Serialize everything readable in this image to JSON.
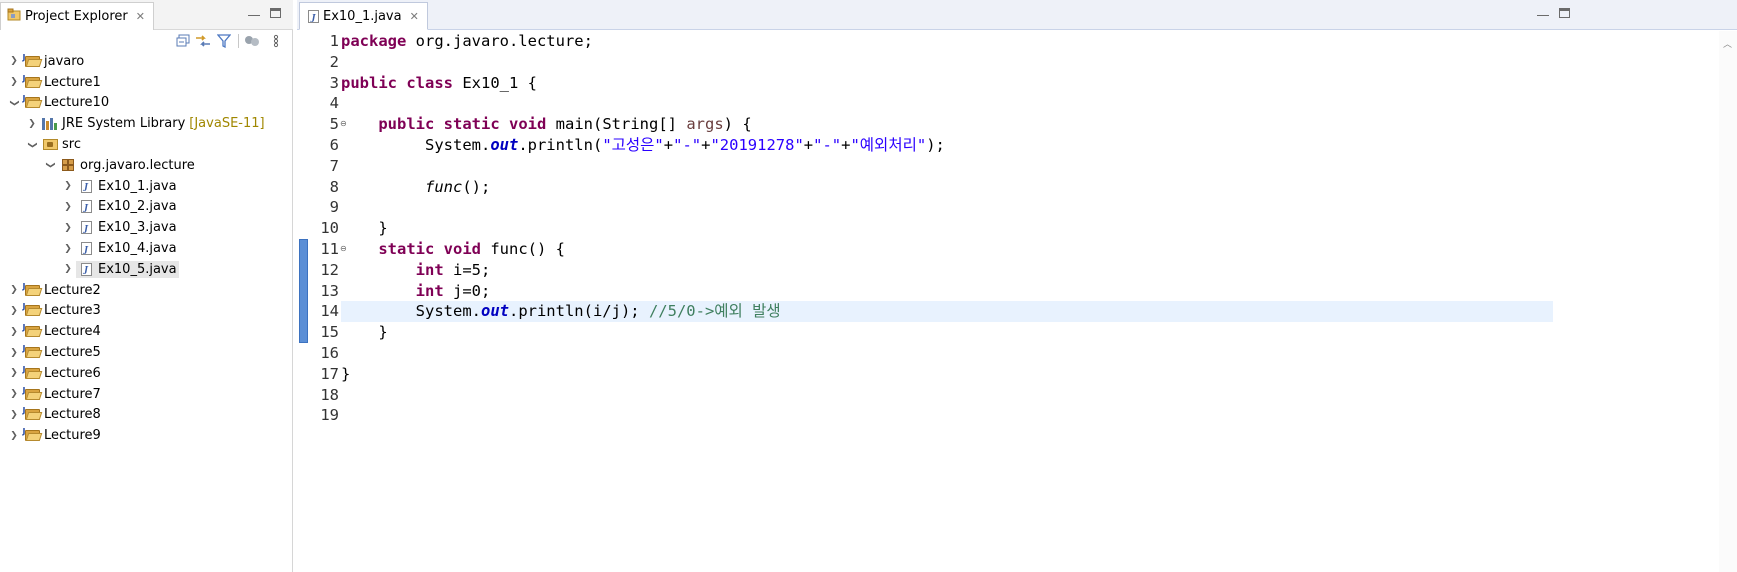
{
  "left_panel": {
    "tab_title": "Project Explorer",
    "tree": [
      {
        "label": "javaro",
        "decor": "",
        "kind": "project"
      },
      {
        "label": "Lecture1",
        "decor": "",
        "kind": "project"
      },
      {
        "label": "Lecture10",
        "decor": "",
        "kind": "project"
      },
      {
        "label": "JRE System Library",
        "decor": "[JavaSE-11]",
        "kind": "library"
      },
      {
        "label": "src",
        "decor": "",
        "kind": "src"
      },
      {
        "label": "org.javaro.lecture",
        "decor": "",
        "kind": "package"
      },
      {
        "label": "Ex10_1.java",
        "decor": "",
        "kind": "file"
      },
      {
        "label": "Ex10_2.java",
        "decor": "",
        "kind": "file"
      },
      {
        "label": "Ex10_3.java",
        "decor": "",
        "kind": "file"
      },
      {
        "label": "Ex10_4.java",
        "decor": "",
        "kind": "file"
      },
      {
        "label": "Ex10_5.java",
        "decor": "",
        "kind": "file"
      },
      {
        "label": "Lecture2",
        "decor": "",
        "kind": "project"
      },
      {
        "label": "Lecture3",
        "decor": "",
        "kind": "project"
      },
      {
        "label": "Lecture4",
        "decor": "",
        "kind": "project"
      },
      {
        "label": "Lecture5",
        "decor": "",
        "kind": "project"
      },
      {
        "label": "Lecture6",
        "decor": "",
        "kind": "project"
      },
      {
        "label": "Lecture7",
        "decor": "",
        "kind": "project"
      },
      {
        "label": "Lecture8",
        "decor": "",
        "kind": "project"
      },
      {
        "label": "Lecture9",
        "decor": "",
        "kind": "project"
      }
    ],
    "selected_item": "Ex10_5.java"
  },
  "editor": {
    "tab_title": "Ex10_1.java",
    "line_numbers": [
      "1",
      "2",
      "3",
      "4",
      "5",
      "6",
      "7",
      "8",
      "9",
      "10",
      "11",
      "12",
      "13",
      "14",
      "15",
      "16",
      "17",
      "18",
      "19"
    ],
    "code": {
      "l1_kw": "package",
      "l1_rest": " org.javaro.lecture;",
      "l3_kw1": "public",
      "l3_kw2": "class",
      "l3_rest": " Ex10_1 {",
      "l5_indent": "    ",
      "l5_kw1": "public",
      "l5_kw2": "static",
      "l5_kw3": "void",
      "l5_a": " main(String[] ",
      "l5_param": "args",
      "l5_b": ") {",
      "l6_indent": "         System.",
      "l6_field": "out",
      "l6_a": ".println(",
      "l6_s1": "\"고성은\"",
      "l6_p1": "+",
      "l6_s2": "\"-\"",
      "l6_p2": "+",
      "l6_s3": "\"20191278\"",
      "l6_p3": "+",
      "l6_s4": "\"-\"",
      "l6_p4": "+",
      "l6_s5": "\"예외처리\"",
      "l6_end": ");",
      "l8_indent": "         ",
      "l8_call": "func",
      "l8_end": "();",
      "l10": "    }",
      "l11_indent": "    ",
      "l11_kw1": "static",
      "l11_kw2": "void",
      "l11_rest": " func() {",
      "l12_indent": "        ",
      "l12_kw": "int",
      "l12_rest": " i=5;",
      "l13_indent": "        ",
      "l13_kw": "int",
      "l13_rest": " j=0;",
      "l14_indent": "        System.",
      "l14_field": "out",
      "l14_a": ".println(i/j); ",
      "l14_comment": "//5/0->예외 발생",
      "l15": "    }",
      "l17": "}"
    },
    "current_line": "14",
    "folding_lines": [
      "5",
      "11"
    ]
  },
  "colors": {
    "keyword": "#7f0055",
    "string": "#2a00ff",
    "field": "#0000c0",
    "comment": "#3f7f5f",
    "current_line_bg": "#e8f2fe",
    "annotation_marker": "#5b8fd6"
  }
}
